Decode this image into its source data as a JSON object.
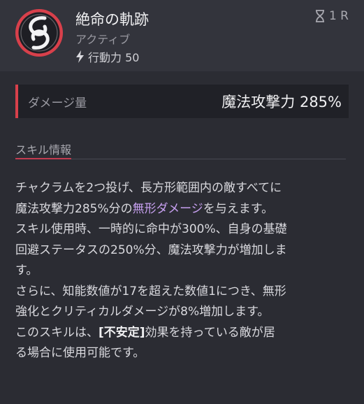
{
  "skill": {
    "name": "絶命の軌跡",
    "type": "アクティブ",
    "action_cost": "行動力 50",
    "cooldown": "1 R"
  },
  "damage": {
    "label": "ダメージ量",
    "value": "魔法攻撃力 285%"
  },
  "section": {
    "title": "スキル情報"
  },
  "description": {
    "l1": "チャクラムを2つ投げ、長方形範囲内の敵すべてに",
    "l2a": "魔法攻撃力285%分の",
    "l2b": "無形ダメージ",
    "l2c": "を与えます。",
    "l3": "スキル使用時、一時的に命中が300%、自身の基礎",
    "l4": "回避ステータスの250%分、魔法攻撃力が増加しま",
    "l5": "す。",
    "l6": "さらに、知能数値が17を超えた数値1につき、無形",
    "l7": "強化とクリティカルダメージが8%増加します。",
    "l8a": "このスキルは、",
    "l8b": "[不安定]",
    "l8c": "効果を持っている敵が居",
    "l9": "る場合に使用可能です。"
  },
  "colors": {
    "accent_red": "#d8404b",
    "highlight_purple": "#c7a0f0",
    "background": "#2b2c33"
  },
  "icons": {
    "skill": "chakram-swirl-icon",
    "cooldown": "hourglass-icon",
    "action": "lightning-bolt-icon"
  }
}
